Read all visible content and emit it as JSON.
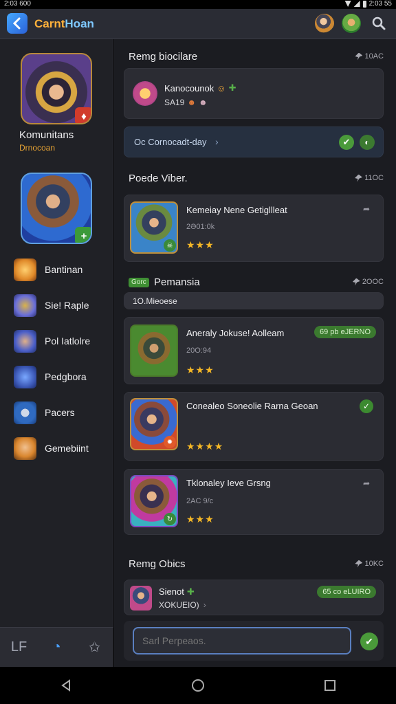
{
  "status_bar": {
    "left_text": "2:03 600",
    "right_text": "2:03 55"
  },
  "app_bar": {
    "title_part1": "Carnt",
    "title_part2": "Hoan"
  },
  "sidebar": {
    "hero_name": "Komunitans",
    "hero_sub": "Drnocoan",
    "items": [
      {
        "label": "Bantinan",
        "icon": "flame-icon",
        "color": "#e08a2a"
      },
      {
        "label": "Sie! Raple",
        "icon": "mech-icon",
        "color": "#6a6fd8"
      },
      {
        "label": "Pol Iatlolre",
        "icon": "knight-icon",
        "color": "#4b5fc9"
      },
      {
        "label": "Pedgbora",
        "icon": "sword-icon",
        "color": "#3d5ab8"
      },
      {
        "label": "Pacers",
        "icon": "orb-icon",
        "color": "#2f6ac0"
      },
      {
        "label": "Gemebiint",
        "icon": "warrior-icon",
        "color": "#d9862e"
      }
    ],
    "bottom_tabs": [
      "LF",
      "home-icon",
      "star-icon"
    ]
  },
  "main": {
    "section1": {
      "title": "Remg biocilare",
      "meta": "10AC"
    },
    "notice_card": {
      "title": "Kanocounok",
      "sub": "SA19"
    },
    "command_bar": {
      "text": "Oc Cornocadt-day",
      "chevron": "›"
    },
    "section2": {
      "title": "Poede Viber.",
      "meta": "11OC"
    },
    "featured": {
      "title": "Kemeiay Nene Getigllleat",
      "sub": "2Ə01:0k",
      "stars": "★★★"
    },
    "section3": {
      "badge": "Gorc",
      "title": "Pemansia",
      "meta": "2OOC"
    },
    "filter": {
      "text": "1O.Mieoese"
    },
    "items": [
      {
        "title": "Aneraly Jokuse! Aolleam",
        "sub": "20O:94",
        "stars": "★★★",
        "pill": "69 pb eJERNO"
      },
      {
        "title": "Conealeo Soneolie Rarna Geoan",
        "sub": "",
        "stars": "★★★★"
      },
      {
        "title": "Tklonaley Ieve Grsng",
        "sub": "2AC 9/c",
        "stars": "★★★"
      }
    ],
    "section4": {
      "title": "Remg Obics",
      "meta": "10KC"
    },
    "footer_card": {
      "title": "Sienot",
      "sub": "XOKUEIO)",
      "chevron": "›",
      "pill": "65 co eLUIRO"
    },
    "search": {
      "placeholder": "Sarl Perpeaos."
    }
  },
  "colors": {
    "accent": "#ffb13b",
    "link": "#4aa0ff",
    "success": "#3b7a2f",
    "panel": "#2b2c33"
  }
}
